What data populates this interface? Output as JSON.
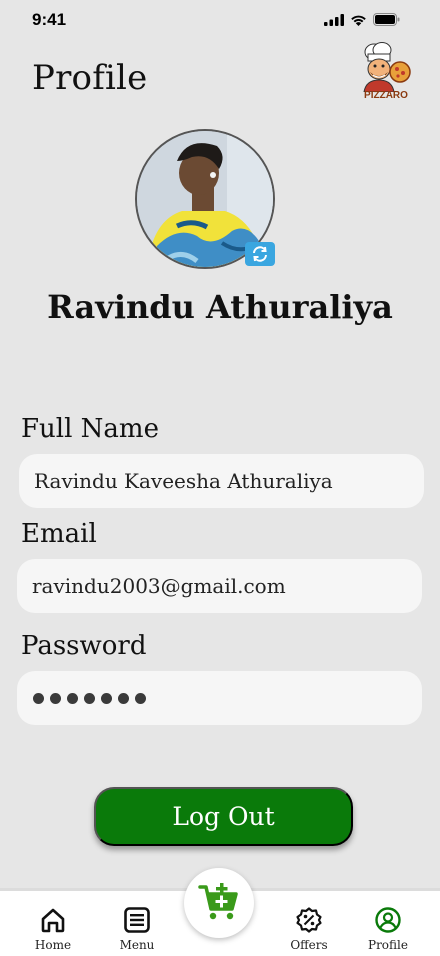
{
  "status_bar": {
    "time": "9:41"
  },
  "header": {
    "title": "Profile",
    "logo_text": "PIZZARO"
  },
  "profile": {
    "name": "Ravindu Athuraliya"
  },
  "fields": {
    "full_name": {
      "label": "Full Name",
      "value": "Ravindu Kaveesha Athuraliya"
    },
    "email": {
      "label": "Email",
      "value": "ravindu2003@gmail.com"
    },
    "password": {
      "label": "Password",
      "masked_length": 7
    }
  },
  "actions": {
    "logout_label": "Log Out"
  },
  "tabbar": {
    "items": [
      {
        "label": "Home",
        "icon": "home-icon"
      },
      {
        "label": "Menu",
        "icon": "menu-icon"
      },
      {
        "label": "Offers",
        "icon": "percent-badge-icon"
      },
      {
        "label": "Profile",
        "icon": "user-circle-icon"
      }
    ],
    "center_button_icon": "add-to-cart-icon"
  },
  "colors": {
    "background": "#e6e6e6",
    "primary_green": "#0a7a0a",
    "cart_green": "#3a9a1a",
    "field_bg": "#f6f6f6",
    "badge_blue": "#3aa6e0"
  }
}
